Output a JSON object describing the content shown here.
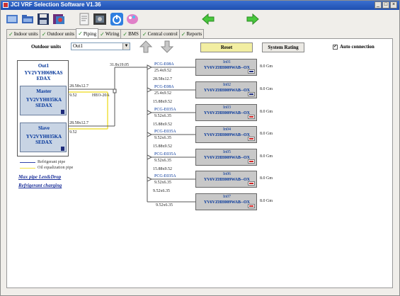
{
  "window": {
    "title": "JCI VRF Selection Software   V1.36"
  },
  "titlebar_buttons": [
    "_",
    "□",
    "×"
  ],
  "tabs": [
    {
      "label": "Indoor units"
    },
    {
      "label": "Outdoor units"
    },
    {
      "label": "Piping"
    },
    {
      "label": "Wiring"
    },
    {
      "label": "BMS"
    },
    {
      "label": "Central control"
    },
    {
      "label": "Reports"
    }
  ],
  "active_tab": "Piping",
  "controls": {
    "outdoor_units_label": "Outdoor units",
    "outdoor_units_value": "Out1",
    "reset_label": "Reset",
    "system_rating_label": "System Rating",
    "auto_connection_label": "Auto connection",
    "auto_connection_checked": true
  },
  "outdoor": {
    "name": "Out1",
    "model": "YV2VYH069KAS\nEDAX",
    "master": {
      "label": "Master",
      "model": "YV2VYH035KA\nSEDAX"
    },
    "slave": {
      "label": "Slave",
      "model": "YV2VYH035KA\nSEDAX"
    }
  },
  "legend": {
    "refrigerant": "Refrigerant pipe",
    "oil": "Oil equalization pipe",
    "refrigerant_color": "#3344aa",
    "oil_color": "#f0e040"
  },
  "links": {
    "max_pipe": "Max pipe Len&Drop",
    "refrigerant_charging": "Refrigerant charging"
  },
  "pipe_labels": {
    "master_gas": "28.58x12.7",
    "master_liq": "9.52",
    "joint": "HEO-20A",
    "slave_gas": "28.58x12.7",
    "slave_liq": "9.52",
    "main": "31.8x19.05"
  },
  "branches": [
    {
      "joint": "PCG-E08A",
      "pipe": "25.4x9.52"
    },
    {
      "joint": "PCG-E08A",
      "pipe": "25.4x9.52"
    },
    {
      "joint": "PCG-E035A",
      "pipe": "9.52x6.35"
    },
    {
      "joint": "PCG-E035A",
      "pipe": "9.52x6.35"
    },
    {
      "joint": "PCG-E035A",
      "pipe": "9.52x6.35"
    },
    {
      "joint": "PCG-E035A",
      "pipe": "9.52x6.35"
    }
  ],
  "segments": [
    "28.58x12.7",
    "15.88x9.52",
    "15.88x9.52",
    "15.88x9.52",
    "15.88x9.52",
    "9.52x6.35"
  ],
  "last_pipe": "9.52x6.35",
  "indoor_units": [
    {
      "name": "In01",
      "model": "YV6VZHH009WAB--OX",
      "capacity": "8.0 Gm",
      "tag_color": "#1d2a7a"
    },
    {
      "name": "In02",
      "model": "YV6VZHH009WAB--OX",
      "capacity": "8.0 Gm",
      "tag_color": "#1d2a7a"
    },
    {
      "name": "In03",
      "model": "YV6VZHH009WAB--OX",
      "capacity": "8.0 Gm",
      "tag_color": "#cc2222"
    },
    {
      "name": "In04",
      "model": "YV6VZHH009WAB--OX",
      "capacity": "8.0 Gm",
      "tag_color": "#cc2222"
    },
    {
      "name": "In05",
      "model": "YV6VZHH009WAB--OX",
      "capacity": "8.0 Gm",
      "tag_color": "#cc2222"
    },
    {
      "name": "In06",
      "model": "YV6VZHH009WAB--OX",
      "capacity": "8.0 Gm",
      "tag_color": "#cc2222"
    },
    {
      "name": "In07",
      "model": "YV6VZHH009WAB--OX",
      "capacity": "8.0 Gm",
      "tag_color": "#cc2222"
    }
  ],
  "icons": [
    "new-file-icon",
    "open-folder-icon",
    "save-disk-icon",
    "project-icon",
    "report-icon",
    "monitor-icon",
    "power-icon",
    "palette-icon",
    "arrow-left-icon",
    "arrow-right-icon",
    "arrow-up-icon",
    "arrow-down-icon"
  ]
}
